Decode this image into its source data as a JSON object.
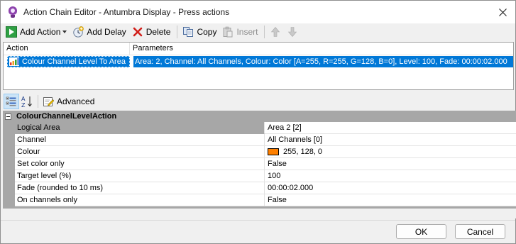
{
  "window": {
    "title": "Action Chain Editor - Antumbra Display - Press actions"
  },
  "toolbar": {
    "add_action": "Add Action",
    "add_delay": "Add Delay",
    "delete": "Delete",
    "copy": "Copy",
    "insert": "Insert"
  },
  "action_list": {
    "columns": [
      "Action",
      "Parameters"
    ],
    "rows": [
      {
        "action": "Colour Channel Level To Area",
        "parameters": "Area: 2, Channel: All Channels, Colour: Color [A=255, R=255, G=128, B=0], Level: 100, Fade: 00:00:02.000"
      }
    ]
  },
  "property_toolbar": {
    "advanced": "Advanced"
  },
  "property_grid": {
    "category": "ColourChannelLevelAction",
    "properties": [
      {
        "name": "Logical Area",
        "value": "Area 2 [2]"
      },
      {
        "name": "Channel",
        "value": "All Channels [0]"
      },
      {
        "name": "Colour",
        "value": "255, 128, 0",
        "swatch": "#ff8000"
      },
      {
        "name": "Set color only",
        "value": "False"
      },
      {
        "name": "Target level (%)",
        "value": "100"
      },
      {
        "name": "Fade (rounded to 10 ms)",
        "value": "00:00:02.000"
      },
      {
        "name": "On channels only",
        "value": "False"
      }
    ]
  },
  "buttons": {
    "ok": "OK",
    "cancel": "Cancel"
  },
  "colors": {
    "selection": "#0078d7",
    "grid_category": "#a7a7a7"
  }
}
